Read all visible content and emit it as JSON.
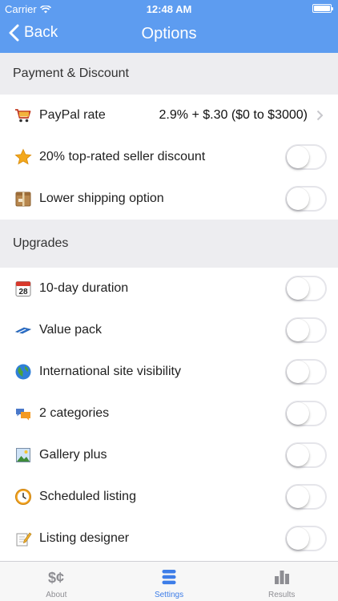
{
  "status_bar": {
    "carrier": "Carrier",
    "time": "12:48 AM"
  },
  "nav": {
    "back_label": "Back",
    "title": "Options"
  },
  "sections": {
    "payment": {
      "title": "Payment & Discount"
    },
    "upgrades": {
      "title": "Upgrades"
    }
  },
  "payment_rows": [
    {
      "label": "PayPal rate",
      "value": "2.9% + $.30 ($0 to $3000)",
      "icon": "shopping-cart-icon"
    },
    {
      "label": "20% top-rated seller discount",
      "icon": "star-icon",
      "on": false
    },
    {
      "label": "Lower shipping option",
      "icon": "package-icon",
      "on": false
    }
  ],
  "upgrade_rows": [
    {
      "label": "10-day duration",
      "icon": "calendar-icon",
      "calendar_day": "28",
      "on": false
    },
    {
      "label": "Value pack",
      "icon": "tag-icon",
      "on": false
    },
    {
      "label": "International site visibility",
      "icon": "globe-icon",
      "on": false
    },
    {
      "label": "2 categories",
      "icon": "chat-bubbles-icon",
      "on": false
    },
    {
      "label": "Gallery plus",
      "icon": "picture-icon",
      "on": false
    },
    {
      "label": "Scheduled listing",
      "icon": "clock-icon",
      "on": false
    },
    {
      "label": "Listing designer",
      "icon": "pencil-paper-icon",
      "on": false
    }
  ],
  "tabbar": [
    {
      "label": "About",
      "icon": "dollar-cent-icon",
      "active": false
    },
    {
      "label": "Settings",
      "icon": "stack-icon",
      "active": true
    },
    {
      "label": "Results",
      "icon": "bar-chart-icon",
      "active": false
    }
  ],
  "colors": {
    "accent": "#5d9cf0",
    "tab_active": "#3d7de8",
    "section_bg": "#ededf0"
  }
}
